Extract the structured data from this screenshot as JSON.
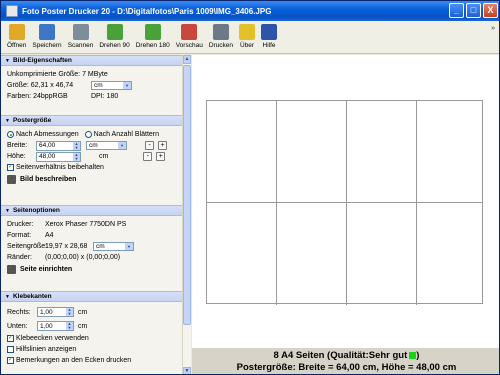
{
  "title": "Foto Poster Drucker 20  - D:\\Digitalfotos\\Paris 1009\\IMG_3406.JPG",
  "window_controls": {
    "minimize": "_",
    "maximize": "□",
    "close": "X"
  },
  "toolbar": {
    "items": [
      {
        "label": "Öffnen",
        "icon": "folder-open-icon",
        "color": "#e0a928"
      },
      {
        "label": "Speichern",
        "icon": "save-disk-icon",
        "color": "#3d78c6"
      },
      {
        "label": "Scannen",
        "icon": "scanner-icon",
        "color": "#7d8e9a"
      },
      {
        "label": "Drehen 90",
        "icon": "rotate-90-icon",
        "color": "#4aa13a"
      },
      {
        "label": "Drehen 180",
        "icon": "rotate-180-icon",
        "color": "#4aa13a"
      },
      {
        "label": "Vorschau",
        "icon": "preview-icon",
        "color": "#c9483b"
      },
      {
        "label": "Drucken",
        "icon": "printer-icon",
        "color": "#6b7a86"
      },
      {
        "label": "Über",
        "icon": "help-about-icon",
        "color": "#e3c12c"
      },
      {
        "label": "Hilfe",
        "icon": "help-book-icon",
        "color": "#2a55a8"
      }
    ],
    "chevron": "»"
  },
  "bild": {
    "header": "Bild-Eigenschaften",
    "size_text": "Unkomprimierte Größe: 7 MByte",
    "groesse_label": "Größe: 62,31 x 46,74",
    "unit": "cm",
    "farben": "Farben: 24bppRGB",
    "dpi": "DPI: 180"
  },
  "poster": {
    "header": "Postergröße",
    "radio1": "Nach Abmessungen",
    "radio2": "Nach Anzahl Blättern",
    "breite_label": "Breite:",
    "breite_value": "64,00",
    "breite_unit": "cm",
    "hoehe_label": "Höhe:",
    "hoehe_value": "48,00",
    "hoehe_unit": "cm",
    "minus": "-",
    "plus": "+",
    "ratio": "Seitenverhältnis beibehalten",
    "describe": "Bild beschreiben"
  },
  "seiten": {
    "header": "Seitenoptionen",
    "drucker_label": "Drucker:",
    "drucker_value": "Xerox Phaser 7750DN PS",
    "format_label": "Format:",
    "format_value": "A4",
    "seitengroesse_label": "Seitengröße:",
    "seitengroesse_value": "19,97 x 28,68",
    "seitengroesse_unit": "cm",
    "raender_label": "Ränder:",
    "raender_value": "(0,00;0,00) x (0,00;0,00)",
    "setup": "Seite einrichten"
  },
  "klebe": {
    "header": "Klebekanten",
    "rechts_label": "Rechts:",
    "rechts_value": "1,00",
    "unten_label": "Unten:",
    "unten_value": "1,00",
    "unit": "cm",
    "check1": "Klebeecken verwenden",
    "check2": "Hilfslinien anzeigen",
    "check3": "Bemerkungen an den Ecken drucken"
  },
  "status": {
    "line1": "8 A4 Seiten (Qualität:Sehr gut",
    "line1_end": ")",
    "line2": "Postergröße: Breite = 64,00 cm, Höhe = 48,00 cm"
  }
}
